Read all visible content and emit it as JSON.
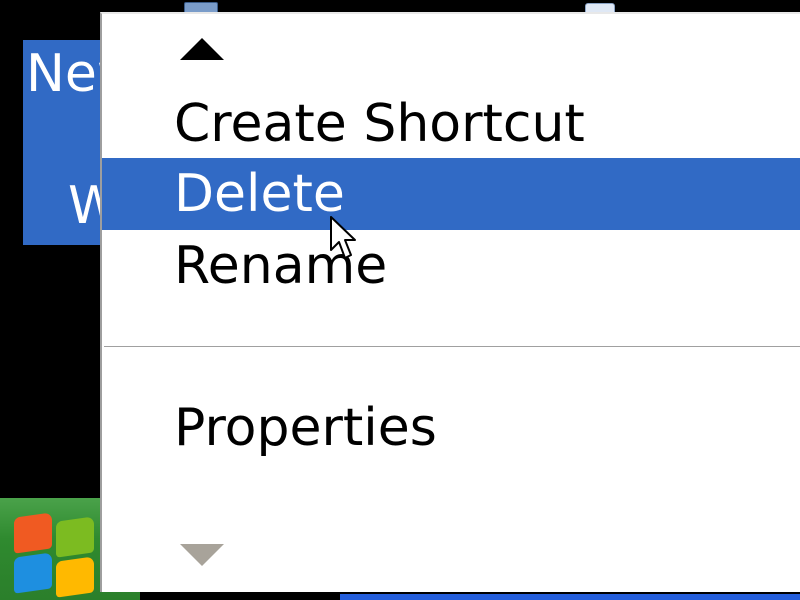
{
  "desktop": {
    "selected_label_line1": "New",
    "selected_label_line2": "W"
  },
  "context_menu": {
    "scroll_up_icon": "triangle-up",
    "scroll_down_icon": "triangle-down",
    "items": [
      {
        "label": "Create Shortcut",
        "selected": false
      },
      {
        "label": "Delete",
        "selected": true
      },
      {
        "label": "Rename",
        "selected": false
      },
      {
        "label": "Properties",
        "selected": false
      }
    ]
  },
  "colors": {
    "selection": "#316AC5",
    "menu_background": "#ffffff",
    "desktop_background": "#000000",
    "disabled_arrow": "#a8a39a"
  }
}
